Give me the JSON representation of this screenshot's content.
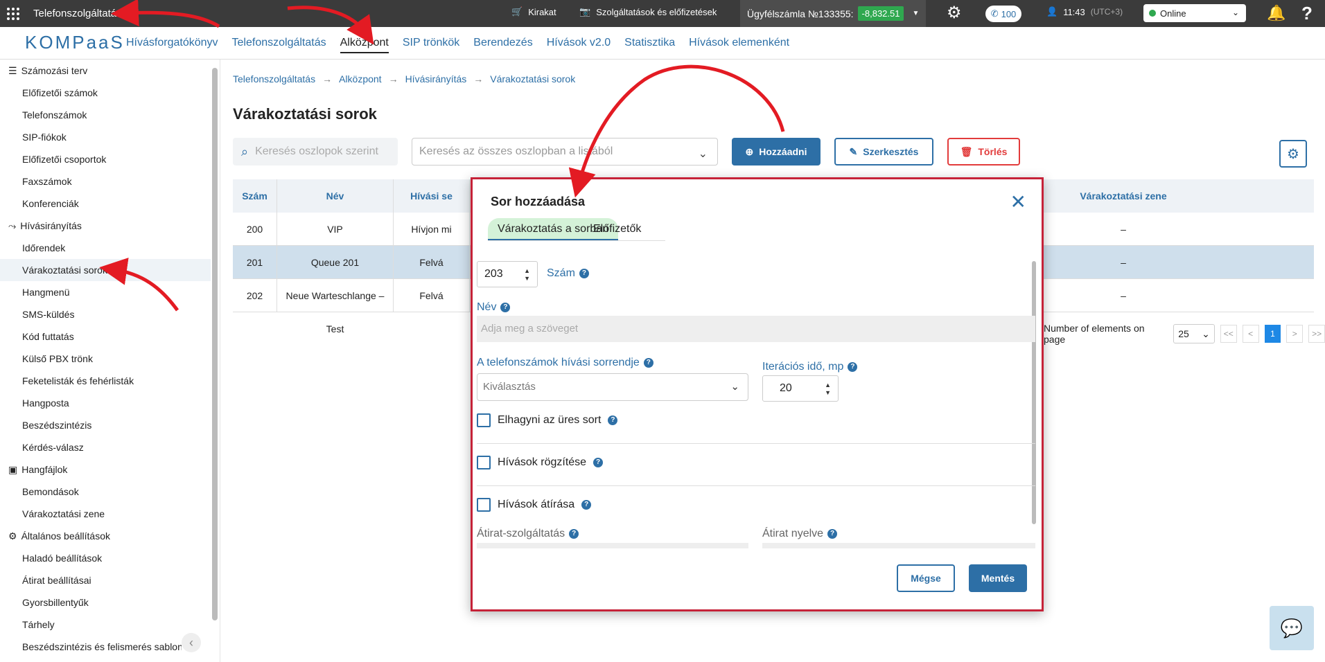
{
  "topbar": {
    "service_title": "Telefonszolgáltatás",
    "showcase": "Kirakat",
    "services": "Szolgáltatások és előfizetések",
    "account_label": "Ügyfélszámla №133355:",
    "balance": "-8,832.51",
    "phone_count": "100",
    "time": "11:43",
    "timezone": "(UTC+3)",
    "status": "Online",
    "help": "?"
  },
  "nav": {
    "logo": "KOMPaaS",
    "tabs": [
      "Hívásforgatókönyv",
      "Telefonszolgáltatás",
      "Alközpont",
      "SIP trönkök",
      "Berendezés",
      "Hívások v2.0",
      "Statisztika",
      "Hívások elemenként"
    ]
  },
  "sidebar": {
    "section1": "Számozási terv",
    "items1": [
      "Előfizetői számok",
      "Telefonszámok",
      "SIP-fiókok",
      "Előfizetői csoportok",
      "Faxszámok",
      "Konferenciák"
    ],
    "section2": "Hívásirányítás",
    "items2": [
      "Időrendek",
      "Várakoztatási sorok",
      "Hangmenü",
      "SMS-küldés",
      "Kód futtatás",
      "Külső PBX trönk",
      "Feketelisták és fehérlisták",
      "Hangposta",
      "Beszédszintézis",
      "Kérdés-válasz"
    ],
    "section3": "Hangfájlok",
    "items3": [
      "Bemondások",
      "Várakoztatási zene"
    ],
    "section4": "Általános beállítások",
    "items4": [
      "Haladó beállítások",
      "Átirat beállításai",
      "Gyorsbillentyűk",
      "Tárhely",
      "Beszédszintézis és felismerés sablon"
    ]
  },
  "breadcrumb": [
    "Telefonszolgáltatás",
    "Alközpont",
    "Hívásirányítás",
    "Várakoztatási sorok"
  ],
  "page_title": "Várakoztatási sorok",
  "toolbar": {
    "search_placeholder": "Keresés oszlopok szerint",
    "search_all_placeholder": "Keresés az összes oszlopban a listából",
    "add": "Hozzáadni",
    "edit": "Szerkesztés",
    "delete": "Törlés"
  },
  "table": {
    "headers": {
      "num": "Szám",
      "name": "Név",
      "strategy": "Hívási se",
      "music": "Várakoztatási zene"
    },
    "rows": [
      {
        "num": "200",
        "name": "VIP",
        "strategy": "Hívjon mi",
        "music": "–"
      },
      {
        "num": "201",
        "name": "Queue 201",
        "strategy": "Felvá",
        "music": "–"
      },
      {
        "num": "202",
        "name": "Neue Warteschlange – Test",
        "strategy": "Felvá",
        "music": "–"
      }
    ]
  },
  "pager": {
    "label": "Number of elements on page",
    "size": "25",
    "first": "<<",
    "prev": "<",
    "current": "1",
    "next": ">",
    "last": ">>"
  },
  "modal": {
    "title": "Sor hozzáadása",
    "tab_queue": "Várakoztatás a sorban",
    "tab_subscribers": "Előfizetők",
    "number_value": "203",
    "number_label": "Szám",
    "name_label": "Név",
    "name_placeholder": "Adja meg a szöveget",
    "order_label": "A telefonszámok hívási sorrendje",
    "order_placeholder": "Kiválasztás",
    "iteration_label": "Iterációs idő, mp",
    "iteration_value": "20",
    "skip_empty": "Elhagyni az üres sort",
    "record_calls": "Hívások rögzítése",
    "transcribe_calls": "Hívások átírása",
    "transcription_service": "Átirat-szolgáltatás",
    "transcription_language": "Átirat nyelve",
    "cancel": "Mégse",
    "save": "Mentés"
  },
  "colors": {
    "brand": "#2d6fa6",
    "highlight": "#c62238",
    "balance": "#2fa84f"
  }
}
